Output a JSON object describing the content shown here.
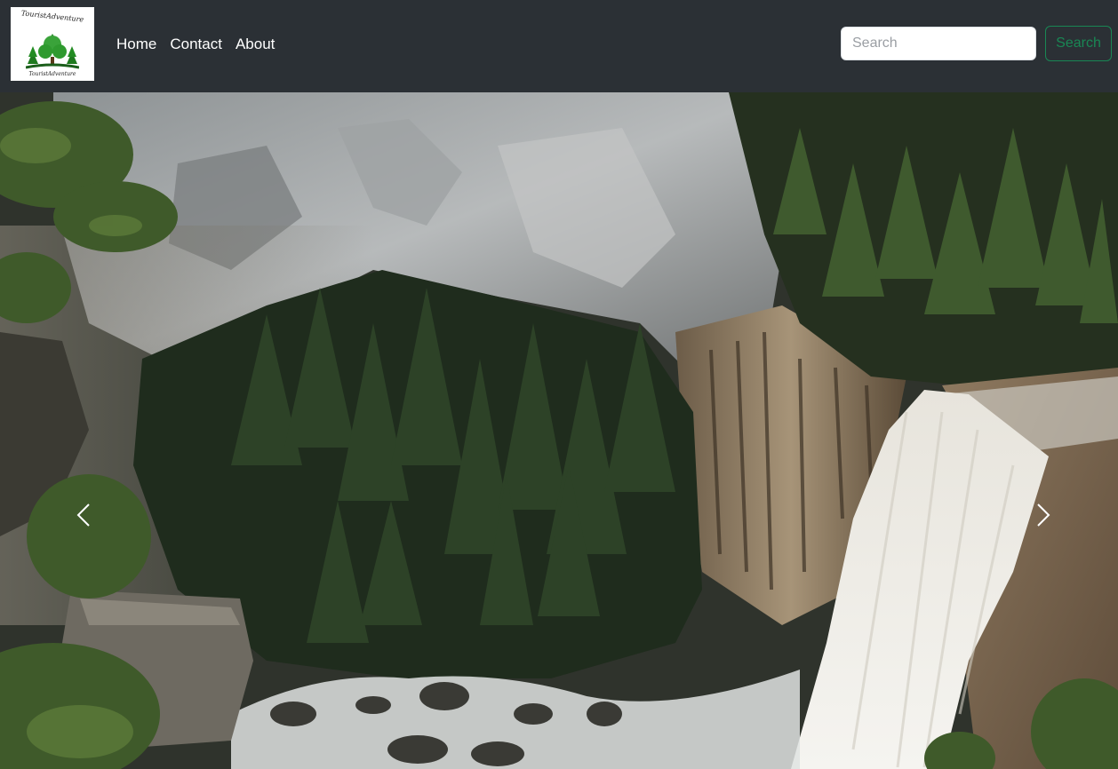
{
  "navbar": {
    "brand": {
      "logo_top_text": "TouristAdventure",
      "logo_bottom_text": "TouristAdventure",
      "icon": "tree-logo-icon"
    },
    "links": [
      {
        "label": "Home"
      },
      {
        "label": "Contact"
      },
      {
        "label": "About"
      }
    ],
    "search": {
      "placeholder": "Search",
      "value": "",
      "button_label": "Search"
    }
  },
  "carousel": {
    "slide_image": "waterfall-canyon-photo",
    "prev_icon": "chevron-left-icon",
    "next_icon": "chevron-right-icon"
  },
  "colors": {
    "navbar_bg": "#2b3035",
    "search_button": "#198754",
    "link_text": "#ffffff"
  }
}
